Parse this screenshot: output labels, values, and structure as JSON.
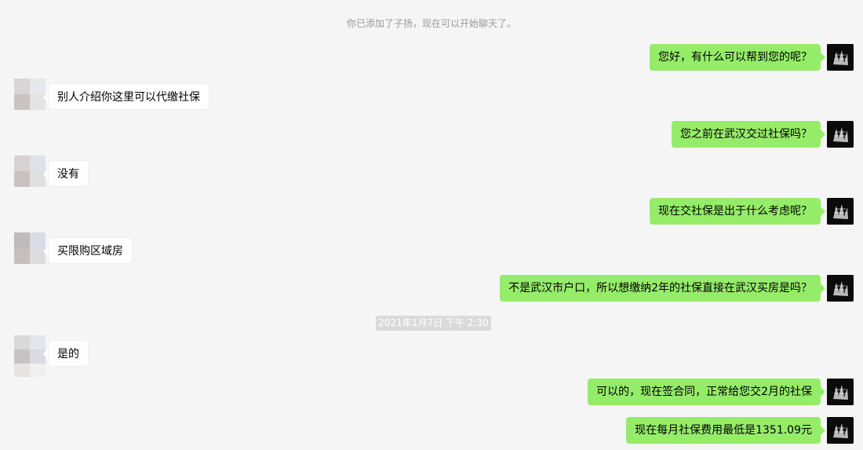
{
  "system_note": "你已添加了子扬，现在可以开始聊天了。",
  "timestamp": "2021年1月7日 下午 2:30",
  "messages": [
    {
      "dir": "out",
      "text": "您好，有什么可以帮到您的呢？"
    },
    {
      "dir": "in",
      "text": "别人介绍你这里可以代缴社保"
    },
    {
      "dir": "out",
      "text": "您之前在武汉交过社保吗？"
    },
    {
      "dir": "in",
      "text": "没有"
    },
    {
      "dir": "out",
      "text": "现在交社保是出于什么考虑呢？"
    },
    {
      "dir": "in",
      "text": "买限购区域房"
    },
    {
      "dir": "out",
      "text": "不是武汉市户口，所以想缴纳2年的社保直接在武汉买房是吗？"
    },
    {
      "dir": "in",
      "text": "是的"
    },
    {
      "dir": "out",
      "text": "可以的，现在签合同，正常给您交2月的社保"
    },
    {
      "dir": "out",
      "text": "现在每月社保费用最低是1351.09元"
    }
  ],
  "colors": {
    "outgoing_bubble": "#95ec69",
    "incoming_bubble": "#ffffff",
    "background": "#f5f5f5"
  },
  "icons": {
    "self_avatar": "dark-photo-avatar",
    "contact_avatar": "pixelated-avatar"
  }
}
